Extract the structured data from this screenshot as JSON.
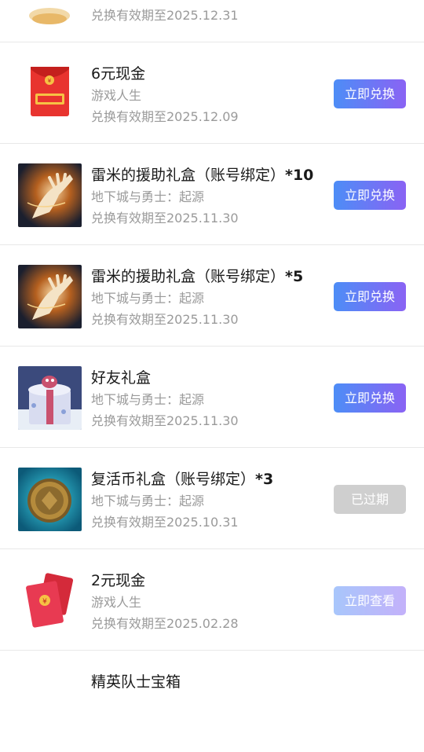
{
  "items": [
    {
      "title": "",
      "title_suffix": "",
      "source": "",
      "date": "兑换有效期至2025.12.31",
      "button": "",
      "icon": "gift-top-partial-icon"
    },
    {
      "title": "6元现金",
      "title_suffix": "",
      "source": "游戏人生",
      "date": "兑换有效期至2025.12.09",
      "button": "立即兑换",
      "icon": "red-envelope-icon"
    },
    {
      "title": "雷米的援助礼盒（账号绑定）",
      "title_suffix": "*10",
      "source": "地下城与勇士：起源",
      "date": "兑换有效期至2025.11.30",
      "button": "立即兑换",
      "icon": "glowing-hand-icon"
    },
    {
      "title": "雷米的援助礼盒（账号绑定）",
      "title_suffix": "*5",
      "source": "地下城与勇士：起源",
      "date": "兑换有效期至2025.11.30",
      "button": "立即兑换",
      "icon": "glowing-hand-icon"
    },
    {
      "title": "好友礼盒",
      "title_suffix": "",
      "source": "地下城与勇士：起源",
      "date": "兑换有效期至2025.11.30",
      "button": "立即兑换",
      "icon": "gift-box-icon"
    },
    {
      "title": "复活币礼盒（账号绑定）",
      "title_suffix": "*3",
      "source": "地下城与勇士：起源",
      "date": "兑换有效期至2025.10.31",
      "button": "已过期",
      "icon": "coin-icon"
    },
    {
      "title": "2元现金",
      "title_suffix": "",
      "source": "游戏人生",
      "date": "兑换有效期至2025.02.28",
      "button": "立即查看",
      "icon": "red-envelope-pair-icon"
    },
    {
      "title": "精英队士宝箱",
      "title_suffix": "",
      "source": "",
      "date": "",
      "button": "",
      "icon": ""
    }
  ],
  "colors": {
    "button_gradient_start": "#4d8df6",
    "button_gradient_end": "#8a63f4",
    "expired_button": "#cfcfcf",
    "title_text": "#1a1a1a",
    "meta_text": "#9a9a9a"
  }
}
